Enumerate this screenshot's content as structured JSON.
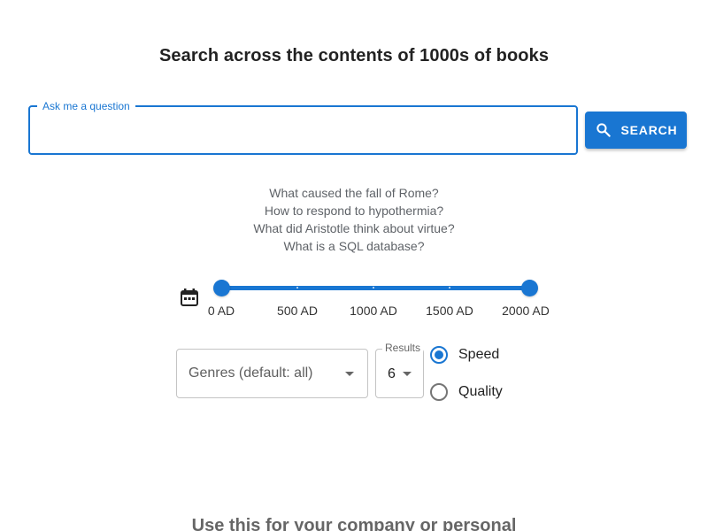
{
  "header": {
    "title": "Search across the contents of 1000s of books"
  },
  "question": {
    "label": "Ask me a question",
    "value": "",
    "placeholder": ""
  },
  "search_button": {
    "icon": "search-icon",
    "label": "SEARCH"
  },
  "examples": [
    "What caused the fall of Rome?",
    "How to respond to hypothermia?",
    "What did Aristotle think about virtue?",
    "What is a SQL database?"
  ],
  "date_range": {
    "icon": "calendar-icon",
    "min_value": 0,
    "max_value": 2000,
    "selected_start": 0,
    "selected_end": 2000,
    "marks": [
      "0 AD",
      "500 AD",
      "1000 AD",
      "1500 AD",
      "2000 AD"
    ],
    "accent_color": "#1976d2"
  },
  "genres": {
    "placeholder": "Genres (default: all)"
  },
  "results": {
    "label": "Results",
    "value": "6"
  },
  "mode": {
    "options": [
      {
        "label": "Speed",
        "selected": true
      },
      {
        "label": "Quality",
        "selected": false
      }
    ]
  },
  "footer": {
    "text": "Use this for your company or personal"
  }
}
